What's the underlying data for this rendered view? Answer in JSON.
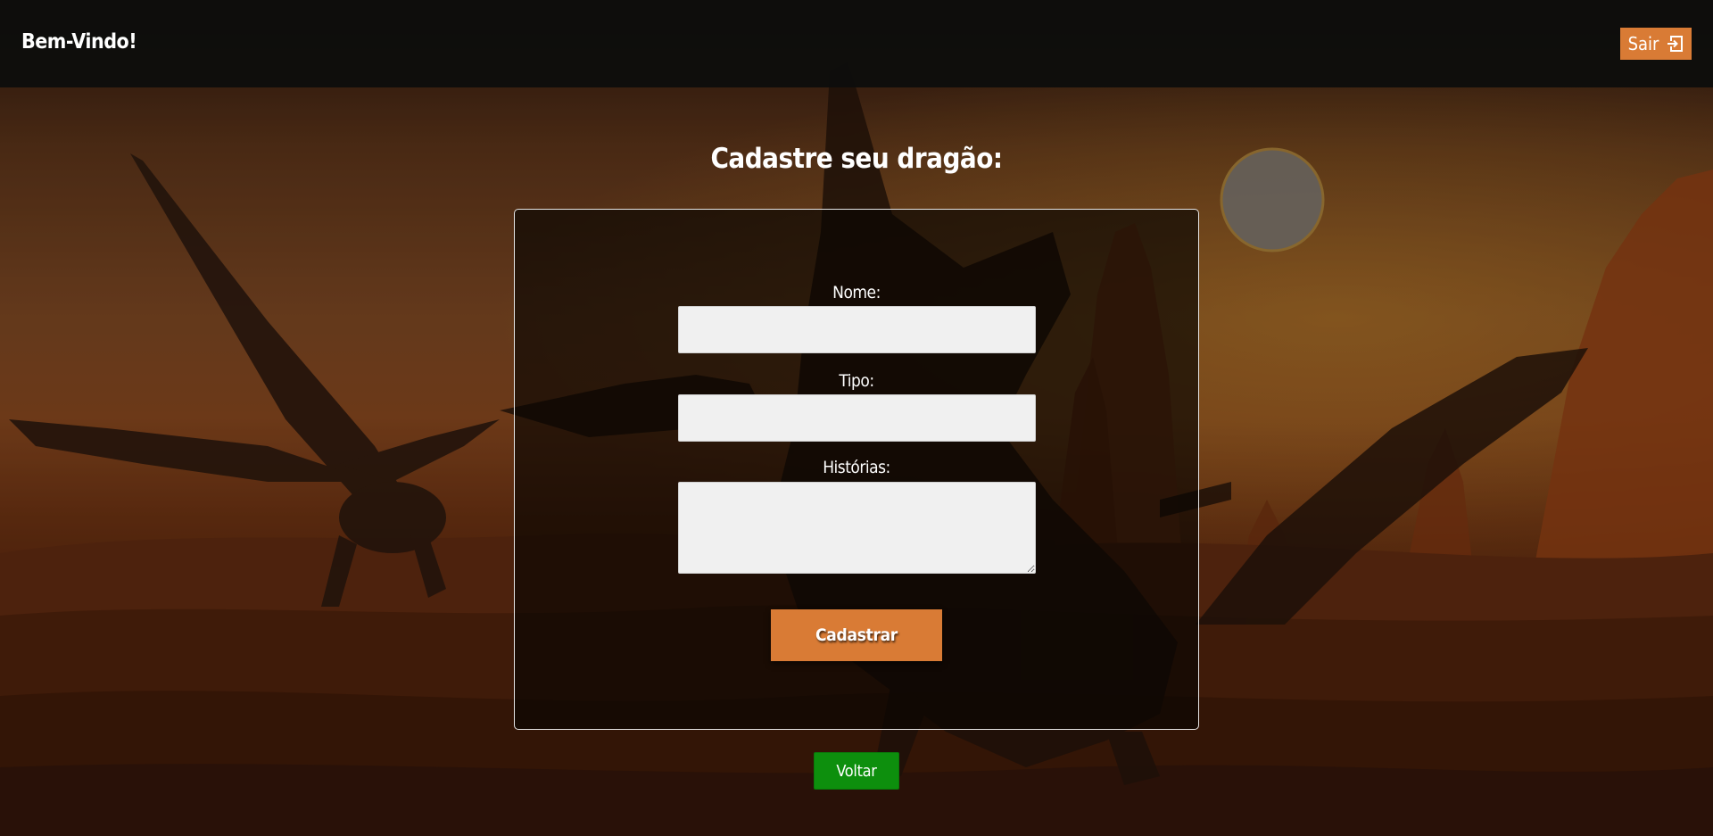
{
  "header": {
    "welcome_text": "Bem-Vindo!",
    "logout_label": "Sair",
    "logout_icon": "sign-out-icon"
  },
  "form": {
    "title": "Cadastre seu dragão:",
    "fields": [
      {
        "label": "Nome:",
        "value": "",
        "placeholder": ""
      },
      {
        "label": "Tipo:",
        "value": "",
        "placeholder": ""
      },
      {
        "label": "Histórias:",
        "value": "",
        "placeholder": ""
      }
    ],
    "submit_label": "Cadastrar"
  },
  "back_label": "Voltar",
  "colors": {
    "accent": "#d97b35",
    "back_button": "#0d8f0d",
    "header_bg": "#0e0e0c",
    "input_bg": "#f0f0f0"
  }
}
